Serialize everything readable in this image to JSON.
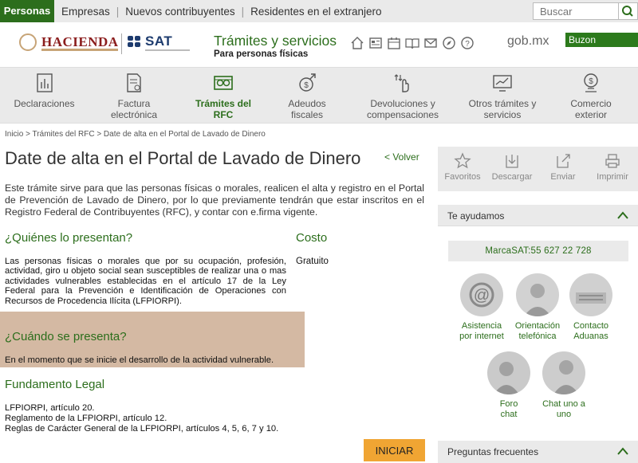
{
  "topbar": {
    "active_tab": "Personas",
    "links": [
      "Empresas",
      "Nuevos contribuyentes",
      "Residentes en el extranjero"
    ],
    "search_placeholder": "Buscar"
  },
  "header": {
    "hacienda_logo_text": "HACIENDA",
    "sat_logo_text": "SAT",
    "title": "Trámites y servicios",
    "subtitle": "Para personas físicas",
    "gobmx": "gob.mx",
    "buzon": "Buzon Tributario",
    "icons": [
      "home-icon",
      "news-icon",
      "calendar-icon",
      "book-icon",
      "mail-icon",
      "compass-icon",
      "help-icon"
    ]
  },
  "categories": [
    {
      "label": "Declaraciones",
      "icon": "chart-doc-icon"
    },
    {
      "label": "Factura electrónica",
      "icon": "invoice-icon"
    },
    {
      "label": "Trámites del RFC",
      "icon": "rfc-icon"
    },
    {
      "label": "Adeudos fiscales",
      "icon": "debt-icon"
    },
    {
      "label": "Devoluciones y compensaciones",
      "icon": "refund-icon"
    },
    {
      "label": "Otros trámites y servicios",
      "icon": "other-services-icon"
    },
    {
      "label": "Comercio exterior",
      "icon": "trade-icon"
    }
  ],
  "breadcrumb": "Inicio > Trámites del RFC > Date de alta en el Portal de Lavado de Dinero",
  "page": {
    "title": "Date de alta en el Portal de Lavado de Dinero",
    "back": "< Volver",
    "intro": "Este trámite sirve para que las personas físicas o morales, realicen el alta y registro en el Portal de Prevención de Lavado de Dinero, por lo que previamente tendrán que estar inscritos en el Registro Federal de Contribuyentes (RFC), y contar con e.firma vigente.",
    "quienes_heading": "¿Quiénes lo presentan?",
    "quienes_text": "Las personas físicas o morales que por su ocupación, profesión, actividad, giro u objeto social sean susceptibles de realizar una o mas actividades vulnerables establecidas en el artículo 17 de la Ley Federal para la Prevención e Identificación de Operaciones con Recursos de Procedencia Ilícita (LFPIORPI).",
    "costo_heading": "Costo",
    "costo_value": "Gratuito",
    "cuando_heading": "¿Cuándo se presenta?",
    "cuando_text": "En el momento que se inicie el desarrollo de la actividad vulnerable.",
    "fundamento_heading": "Fundamento Legal",
    "fundamento": [
      "LFPIORPI, artículo 20.",
      "Reglamento de la LFPIORPI, artículo 12.",
      "Reglas de Carácter General de la LFPIORPI, artículos 4, 5, 6, 7 y 10."
    ],
    "iniciar": "INICIAR"
  },
  "sidebar": {
    "actions": [
      "Favoritos",
      "Descargar",
      "Enviar",
      "Imprimir"
    ],
    "ayudamos": "Te ayudamos",
    "marcasat": "MarcaSAT:55 627 22 728",
    "contacts": [
      {
        "line1": "Asistencia",
        "line2": "por internet"
      },
      {
        "line1": "Orientación",
        "line2": "telefónica"
      },
      {
        "line1": "Contacto",
        "line2": "Aduanas"
      },
      {
        "line1": "Foro",
        "line2": "chat"
      },
      {
        "line1": "Chat uno a",
        "line2": "uno"
      }
    ],
    "preguntas": "Preguntas frecuentes"
  },
  "colors": {
    "brand_green": "#2c6e1c",
    "highlight": "#d4b9a3",
    "button": "#f0a533",
    "gray_bar": "#eaeaea"
  }
}
